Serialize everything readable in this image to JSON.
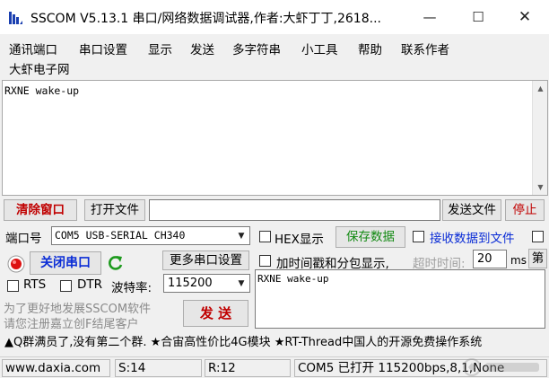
{
  "window": {
    "title": "SSCOM V5.13.1 串口/网络数据调试器,作者:大虾丁丁,2618...",
    "min_glyph": "—",
    "max_glyph": "☐",
    "close_glyph": "✕"
  },
  "menu": {
    "items": [
      "通讯端口",
      "串口设置",
      "显示",
      "发送",
      "多字符串",
      "小工具",
      "帮助",
      "联系作者"
    ],
    "second_row": "大虾电子网"
  },
  "receive": {
    "text": "RXNE wake-up"
  },
  "toolbar": {
    "clear_label": "清除窗口",
    "open_file_label": "打开文件",
    "file_path": "",
    "send_file_label": "发送文件",
    "stop_label": "停止"
  },
  "port": {
    "port_label": "端口号",
    "port_value": "COM5 USB-SERIAL CH340",
    "close_port_label": "关闭串口",
    "more_settings_label": "更多串口设置",
    "rts_label": "RTS",
    "dtr_label": "DTR",
    "baud_label": "波特率:",
    "baud_value": "115200"
  },
  "options": {
    "hex_display_label": "HEX显示",
    "save_data_label": "保存数据",
    "recv_to_file_label": "接收数据到文件",
    "timestamp_label": "加时间戳和分包显示,",
    "timeout_label": "超时时间:",
    "timeout_value": "20",
    "timeout_unit": "ms",
    "page_label": "第"
  },
  "promo": {
    "line1": "为了更好地发展SSCOM软件",
    "line2": "请您注册嘉立创F结尾客户"
  },
  "send": {
    "send_label": "发 送",
    "text": "RXNE wake-up"
  },
  "ticker": {
    "text": "▲Q群满员了,没有第二个群. ★合宙高性价比4G模块 ★RT-Thread中国人的开源免费操作系统"
  },
  "status": {
    "website": "www.daxia.com",
    "sent": "S:14",
    "received": "R:12",
    "port_state": "COM5 已打开  115200bps,8,1,None"
  },
  "colors": {
    "accent_red": "#c00000",
    "accent_green": "#138a13",
    "accent_blue": "#0a2cd6"
  }
}
